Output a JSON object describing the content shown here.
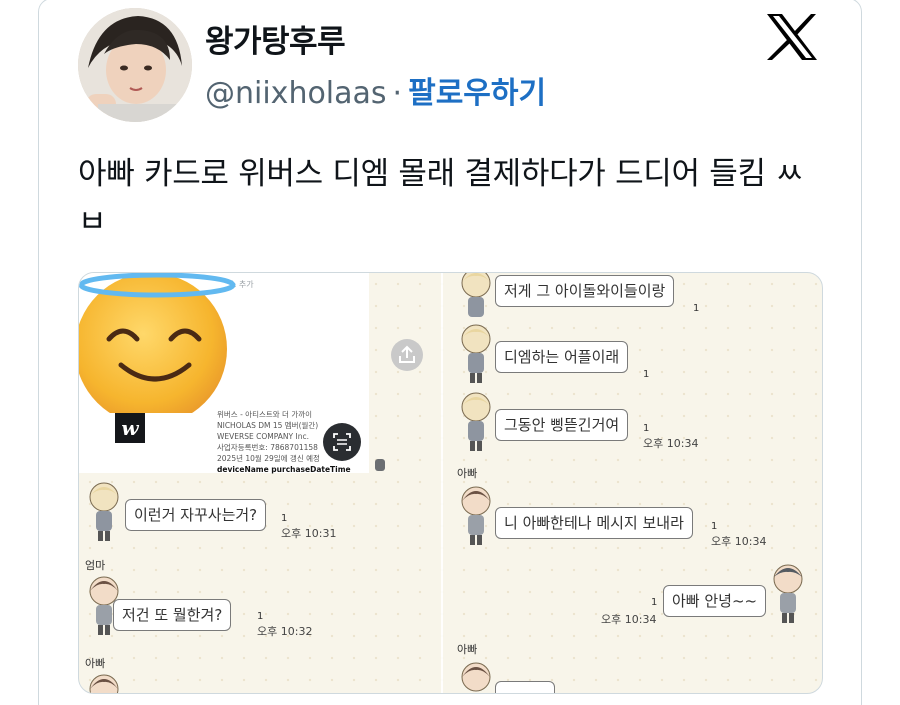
{
  "user": {
    "display_name": "왕가탕후루",
    "handle": "@niixholaas",
    "separator": "·",
    "follow_label": "팔로우하기"
  },
  "tweet": {
    "text": "아빠 카드로 위버스 디엠 몰래 결제하다가 드디어 들킴 ㅆㅂ"
  },
  "media": {
    "receipt": {
      "top_text": "소 추가",
      "logo_letter": "w",
      "lines": [
        "위버스 - 아티스트와 더 가까이",
        "NICHOLAS DM 15 멤버(월간)",
        "WEVERSE COMPANY Inc.",
        "사업자등록번호: 7868701158",
        "2025년 10월 29일에 갱신 예정"
      ],
      "fields": "deviceName   purchaseDateTime"
    },
    "left_chat": [
      {
        "text": "이런거 자꾸사는거?",
        "count": "1",
        "time": "오후 10:31"
      },
      {
        "sender": "엄마",
        "text": "저건 또 뭘한겨?",
        "count": "1",
        "time": "오후 10:32"
      },
      {
        "sender": "아빠"
      }
    ],
    "right_chat": [
      {
        "text": "저게 그 아이돌와이들이랑",
        "count": "1"
      },
      {
        "text": "디엠하는 어플이래",
        "count": "1"
      },
      {
        "text": "그동안 삥뜯긴거여",
        "count": "1",
        "time": "오후 10:34"
      },
      {
        "sender": "아빠",
        "text": "니 아빠한테나 메시지 보내라",
        "count": "1",
        "time": "오후 10:34"
      },
      {
        "text": "아빠 안녕~~",
        "count": "1",
        "time": "오후 10:34"
      },
      {
        "sender": "아빠"
      }
    ]
  },
  "colors": {
    "follow": "#1d6fc4",
    "handle": "#536471",
    "chat_background": "#f8f5ea"
  },
  "icons": [
    "x-logo-icon",
    "share-icon",
    "scan-icon",
    "emoji-halo-smile"
  ]
}
